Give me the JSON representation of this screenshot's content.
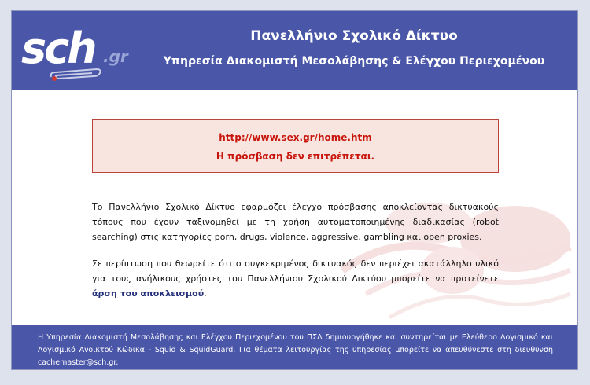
{
  "header": {
    "logo_text": "sch",
    "logo_suffix": ".gr",
    "title": "Πανελλήνιο Σχολικό Δίκτυο",
    "subtitle": "Υπηρεσία Διακομιστή Μεσολάβησης & Ελέγχου Περιεχομένου"
  },
  "alert": {
    "url": "http://www.sex.gr/home.htm",
    "message": "Η πρόσβαση δεν επιτρέπεται."
  },
  "content": {
    "paragraph1": "Το Πανελλήνιο Σχολικό Δίκτυο εφαρμόζει έλεγχο πρόσβασης αποκλείοντας δικτυακούς τόπους που έχουν ταξινομηθεί με τη χρήση αυτοματοποιημένης διαδικασίας (robot searching) στις κατηγορίες porn, drugs, violence, aggressive, gambling και open proxies.",
    "paragraph2_prefix": "Σε περίπτωση που θεωρείτε ότι ο συγκεκριμένος δικτυακός δεν περιέχει ακατάλληλο υλικό για τους ανήλικους χρήστες του Πανελλήνιου Σχολικού Δικτύου μπορείτε να προτείνετε ",
    "unblock_link": "άρση του αποκλεισμού",
    "paragraph2_suffix": "."
  },
  "footer": {
    "text": "Η Υπηρεσία Διακομιστή Μεσολάβησης και Ελέγχου Περιεχομένου του ΠΣΔ δημιουργήθηκε και συντηρείται με Ελεύθερο Λογισμικό και Λογισμικό Ανοικτού Κώδικα - Squid & SquidGuard. Για θέματα λειτουργίας της υπηρεσίας μπορείτε να απευθύνεστε στη διευθυνση cachemaster@sch.gr."
  },
  "colors": {
    "header_bg": "#4a56a8",
    "alert_text": "#c8160d",
    "alert_bg": "#f8e5df",
    "link": "#24307a"
  }
}
